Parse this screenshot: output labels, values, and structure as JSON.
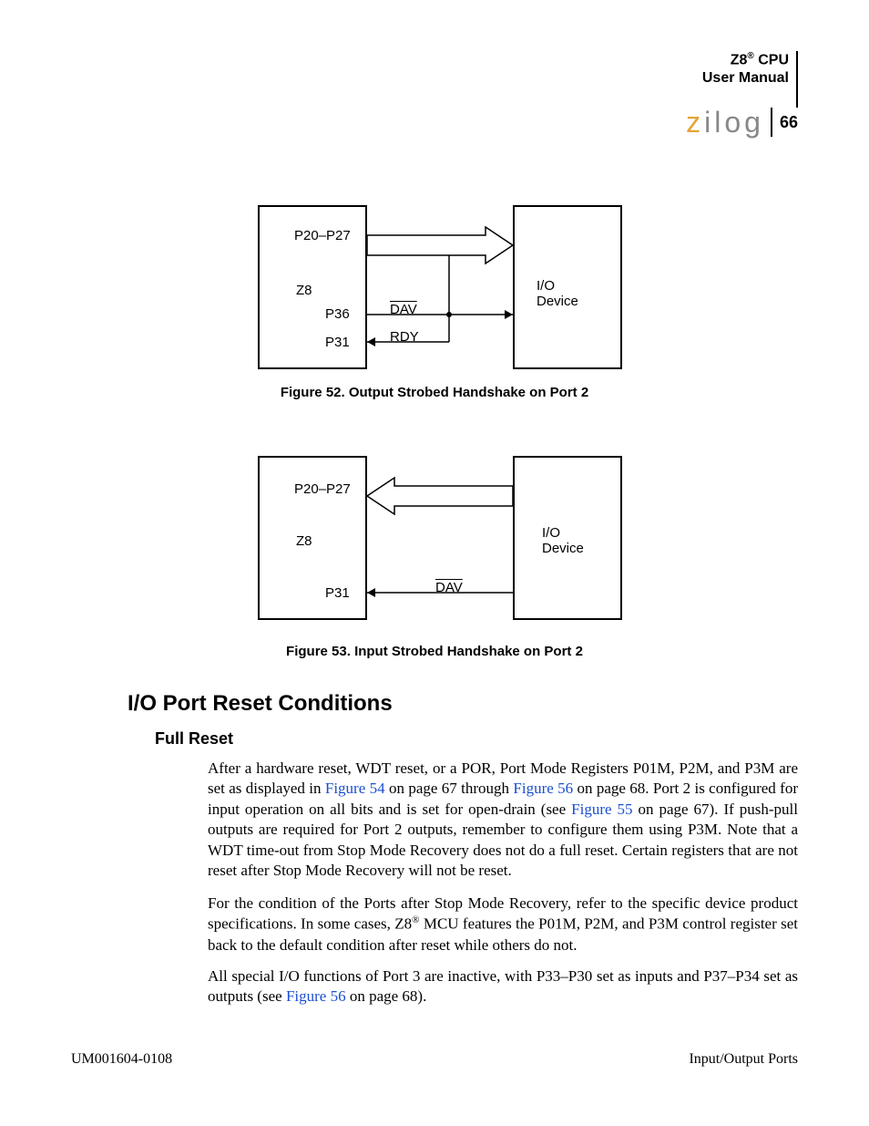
{
  "header": {
    "product": "Z8",
    "reg": "®",
    "cpu": " CPU",
    "manual": "User Manual",
    "logo_z": "z",
    "logo_rest": "ilog",
    "page_number": "66"
  },
  "figure52": {
    "left_block_title": "Z8",
    "port_range": "P20–P27",
    "p36": "P36",
    "p31": "P31",
    "dav": "DAV",
    "rdy": "RDY",
    "right_block_l1": "I/O",
    "right_block_l2": "Device",
    "caption": "Figure 52. Output Strobed Handshake on Port 2"
  },
  "figure53": {
    "left_block_title": "Z8",
    "port_range": "P20–P27",
    "p31": "P31",
    "dav": "DAV",
    "right_block_l1": "I/O",
    "right_block_l2": "Device",
    "caption": "Figure 53. Input Strobed Handshake on Port 2"
  },
  "sections": {
    "h1": "I/O Port Reset Conditions",
    "h2": "Full Reset"
  },
  "body": {
    "p1a": "After a hardware reset, WDT reset, or a POR, Port Mode Registers P01M, P2M, and P3M are set as displayed in ",
    "p1_link1": "Figure 54",
    "p1b": " on page 67 through ",
    "p1_link2": "Figure 56",
    "p1c": " on page 68. Port 2 is configured for input operation on all bits and is set for open-drain (see ",
    "p1_link3": "Figure 55",
    "p1d": " on page 67). If push-pull outputs are required for Port 2 outputs, remember to configure them using P3M. Note that a WDT time-out from Stop Mode Recovery does not do a full reset. Certain registers that are not reset after Stop Mode Recovery will not be reset.",
    "p2a": "For the condition of the Ports after Stop Mode Recovery, refer to the specific device product specifications. In some cases, Z8",
    "p2_reg": "®",
    "p2b": " MCU features the P01M, P2M, and P3M control register set back to the default condition after reset while others do not.",
    "p3a": "All special I/O functions of Port 3 are inactive, with P33–P30 set as inputs and P37–P34 set as outputs (see ",
    "p3_link": "Figure 56",
    "p3b": " on page 68)."
  },
  "footer": {
    "left": "UM001604-0108",
    "right": "Input/Output Ports"
  }
}
